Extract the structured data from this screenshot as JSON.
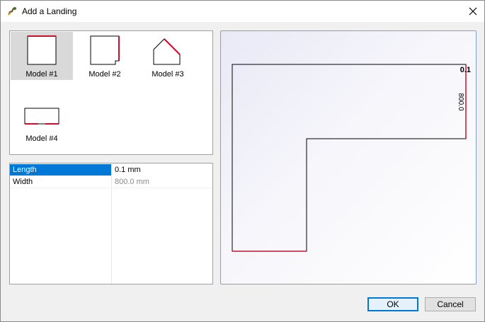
{
  "window": {
    "title": "Add a Landing",
    "app_icon": "landing-app-icon",
    "close_icon": "close-icon"
  },
  "models": [
    {
      "label": "Model #1",
      "selected": true
    },
    {
      "label": "Model #2",
      "selected": false
    },
    {
      "label": "Model #3",
      "selected": false
    },
    {
      "label": "Model #4",
      "selected": false
    }
  ],
  "properties": [
    {
      "name": "Length",
      "value": "0.1 mm",
      "selected": true,
      "enabled": true
    },
    {
      "name": "Width",
      "value": "800.0 mm",
      "selected": false,
      "enabled": false
    }
  ],
  "preview": {
    "length_label": "0.1",
    "width_label": "800.0",
    "accent_color": "#c8102e"
  },
  "buttons": {
    "ok": "OK",
    "cancel": "Cancel"
  }
}
